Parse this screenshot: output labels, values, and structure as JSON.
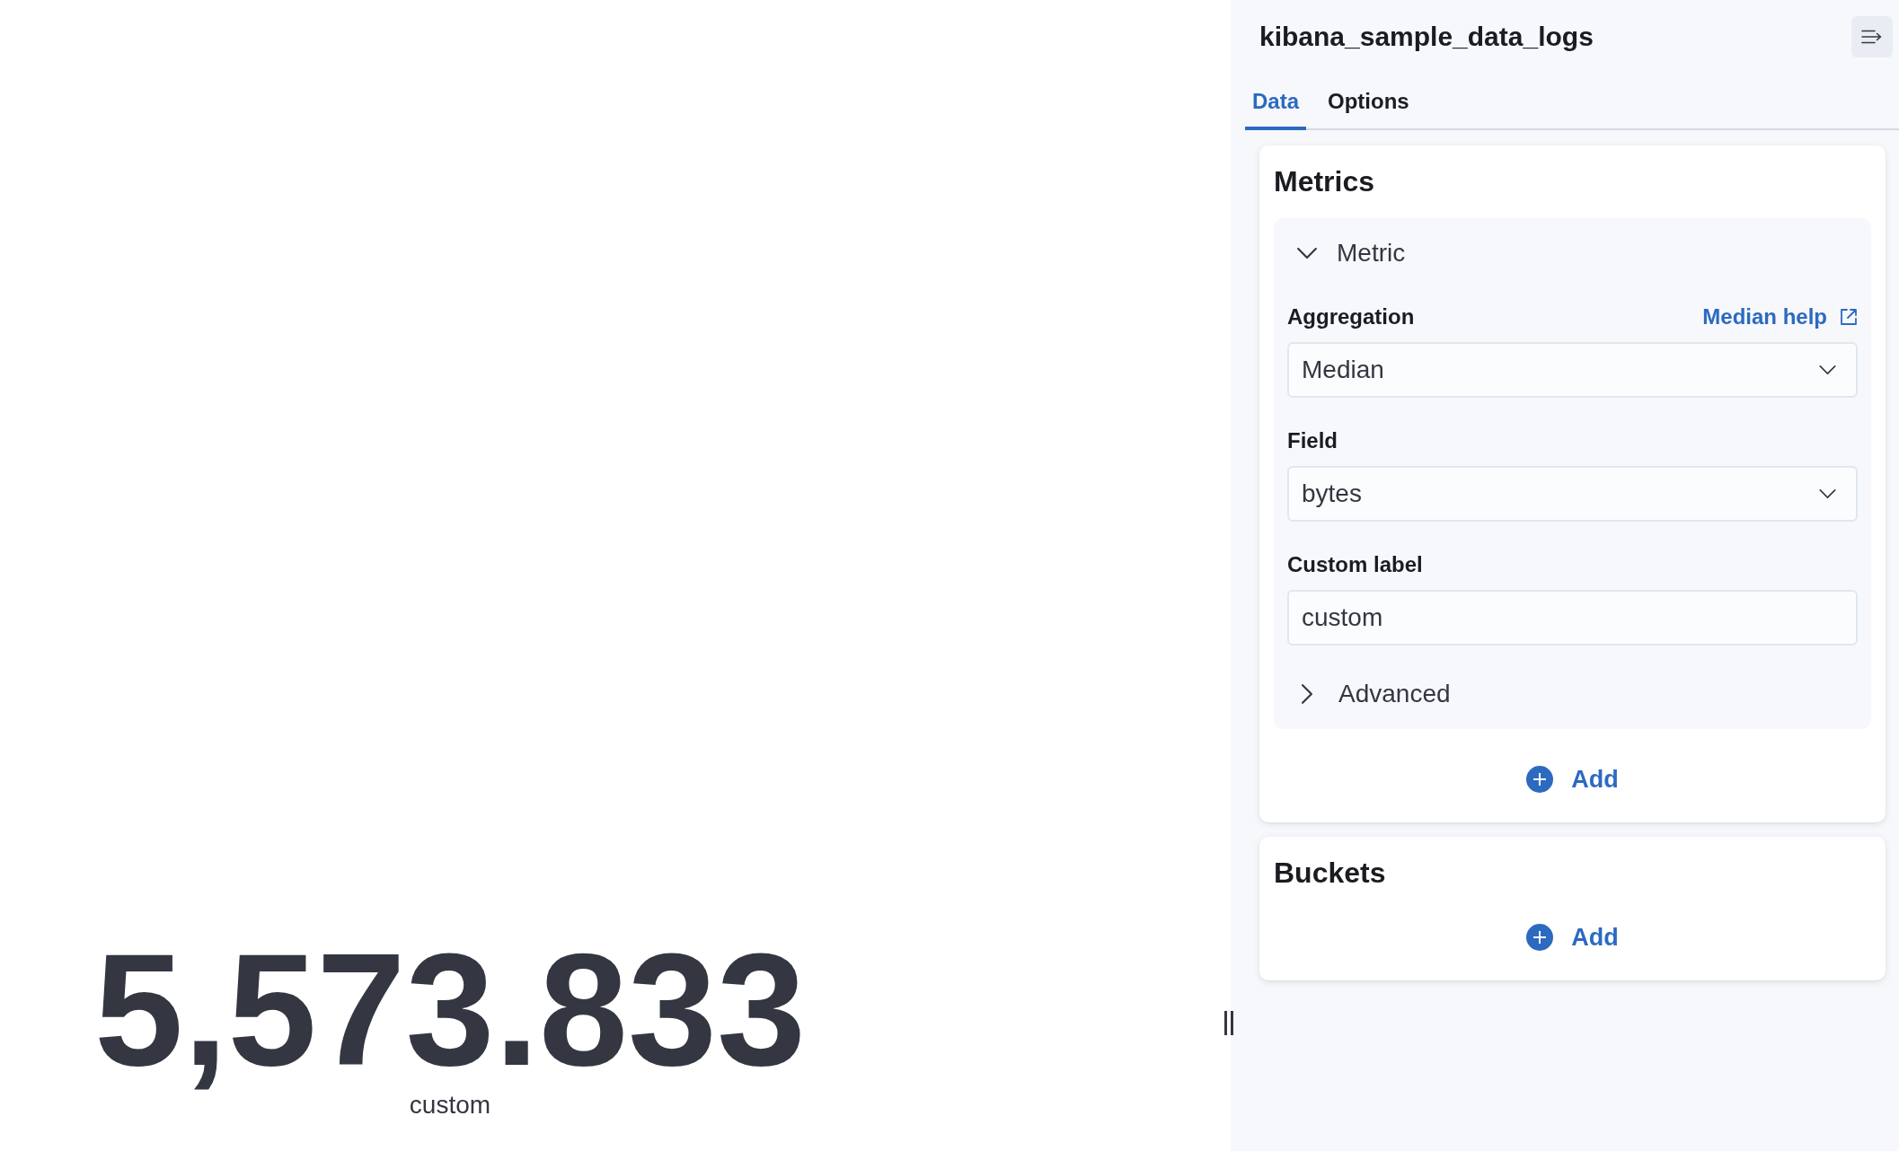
{
  "visualization": {
    "value": "5,573.833",
    "label": "custom"
  },
  "sidebar": {
    "title": "kibana_sample_data_logs",
    "tabs": [
      {
        "label": "Data",
        "selected": true
      },
      {
        "label": "Options",
        "selected": false
      }
    ],
    "sections": [
      {
        "title": "Metrics",
        "aggregations": [
          {
            "title": "Metric",
            "expanded": true,
            "fields": [
              {
                "kind": "select",
                "label": "Aggregation",
                "help_link": "Median help",
                "value": "Median"
              },
              {
                "kind": "select",
                "label": "Field",
                "value": "bytes"
              },
              {
                "kind": "text",
                "label": "Custom label",
                "value": "custom"
              }
            ],
            "advanced": {
              "label": "Advanced",
              "expanded": false
            }
          }
        ],
        "add_label": "Add"
      },
      {
        "title": "Buckets",
        "add_label": "Add"
      }
    ]
  }
}
